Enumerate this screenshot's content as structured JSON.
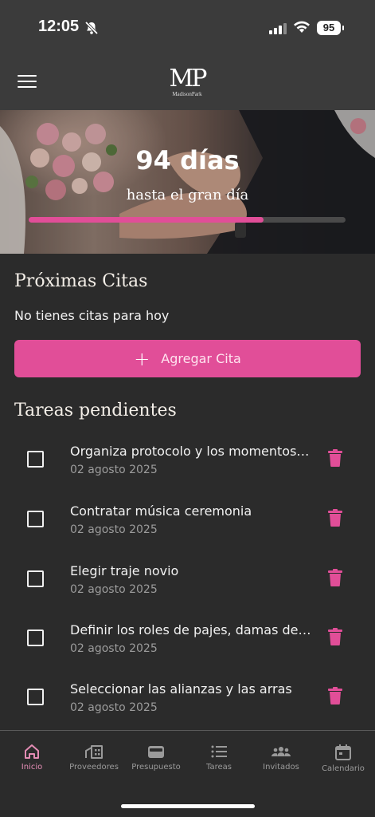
{
  "status_bar": {
    "time": "12:05",
    "battery": "95",
    "icons": [
      "bell-slash-icon",
      "cellular-signal-icon",
      "wifi-icon",
      "battery-icon"
    ]
  },
  "header": {
    "logo_mark": "MP",
    "logo_sub": "MadisonPark",
    "icons": [
      "menu-icon"
    ]
  },
  "hero": {
    "countdown": "94 días",
    "subtitle": "hasta el gran día",
    "progress": 0.74,
    "colors": {
      "progress_fill": "#e14e98",
      "progress_track": "#4a4a4a"
    }
  },
  "appointments": {
    "title": "Próximas Citas",
    "empty_text": "No tienes citas para hoy",
    "add_label": "Agregar Cita"
  },
  "tasks": {
    "title": "Tareas pendientes",
    "items": [
      {
        "title": "Organiza protocolo y los momentos especiales",
        "date": "02 agosto 2025"
      },
      {
        "title": "Contratar música ceremonia",
        "date": "02 agosto 2025"
      },
      {
        "title": "Elegir traje novio",
        "date": "02 agosto 2025"
      },
      {
        "title": "Definir los roles de pajes, damas de honor",
        "date": "02 agosto 2025"
      },
      {
        "title": "Seleccionar las alianzas y las arras",
        "date": "02 agosto 2025"
      }
    ]
  },
  "nav": {
    "items": [
      {
        "label": "Inicio",
        "icon": "home-icon",
        "active": true
      },
      {
        "label": "Proveedores",
        "icon": "store-icon"
      },
      {
        "label": "Presupuesto",
        "icon": "wallet-icon"
      },
      {
        "label": "Tareas",
        "icon": "list-icon"
      },
      {
        "label": "Invitados",
        "icon": "people-icon"
      },
      {
        "label": "Calendario",
        "icon": "calendar-icon"
      }
    ]
  },
  "colors": {
    "accent": "#e14e98",
    "background": "#2b2b2b",
    "header": "#3b3b3b"
  }
}
